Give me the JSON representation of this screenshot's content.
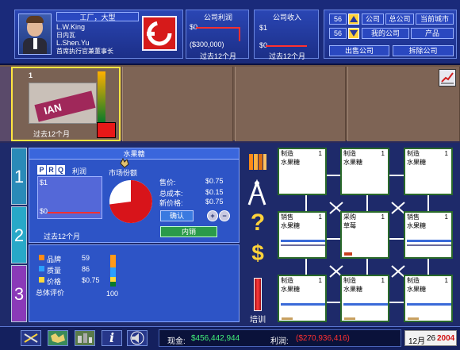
{
  "header": {
    "company_type": "工厂，大型",
    "people": [
      {
        "name": "L.W.King",
        "role": "日内瓦"
      },
      {
        "name": "L.Shen.Yu",
        "role": "首席执行官兼董事长"
      }
    ],
    "profit": {
      "title": "公司利润",
      "top_value": "$0",
      "amount": "($300,000)",
      "period": "过去12个月"
    },
    "revenue": {
      "title": "公司收入",
      "top_value": "$1",
      "bottom_value": "$0",
      "period": "过去12个月"
    },
    "nav": {
      "row1_num": "56",
      "row2_num": "56",
      "company": "公司",
      "head_office": "总公司",
      "current_city": "当前城市",
      "my_company": "我的公司",
      "product": "产品",
      "sell_company": "出售公司",
      "demolish_company": "拆除公司"
    }
  },
  "slots": [
    {
      "num": "1",
      "period": "过去12个月",
      "product_text": "IAN"
    }
  ],
  "detail": {
    "product_name": "水果糖",
    "pqr": [
      "P",
      "R",
      "Q"
    ],
    "profit_label": "利润",
    "share_label": "市场份额",
    "chart_top": "$1",
    "chart_bottom": "$0",
    "chart_period": "过去12个月",
    "price_label": "售价:",
    "price_value": "$0.75",
    "cost_label": "总成本:",
    "cost_value": "$0.15",
    "new_price_label": "新价格:",
    "new_price_value": "$0.75",
    "confirm": "确认",
    "internal": "内销",
    "stats": [
      {
        "label": "品牌",
        "value": "59",
        "color": "#ff8a18"
      },
      {
        "label": "质量",
        "value": "86",
        "color": "#2aa0ff"
      },
      {
        "label": "价格",
        "value": "$0.75",
        "color": "#ffd83a"
      }
    ],
    "overall_label": "总体评价",
    "overall_value": "100",
    "tabs": [
      "1",
      "2",
      "3"
    ]
  },
  "sidetools": {
    "train_label": "培训"
  },
  "cards": [
    {
      "type": "制造",
      "num": "1",
      "item": "水果糖"
    },
    {
      "type": "制造",
      "num": "1",
      "item": "水果糖"
    },
    {
      "type": "制造",
      "num": "1",
      "item": "水果糖"
    },
    {
      "type": "销售",
      "num": "1",
      "item": "水果糖"
    },
    {
      "type": "采购",
      "num": "1",
      "item": "草莓"
    },
    {
      "type": "销售",
      "num": "1",
      "item": "水果糖"
    },
    {
      "type": "制造",
      "num": "1",
      "item": "水果糖"
    },
    {
      "type": "制造",
      "num": "1",
      "item": "水果糖"
    },
    {
      "type": "制造",
      "num": "1",
      "item": "水果糖"
    }
  ],
  "footer": {
    "cash_label": "现金:",
    "cash_value": "$456,442,944",
    "profit_label": "利润:",
    "profit_value": "($270,936,416)",
    "month": "12月",
    "day": "26",
    "year": "2004"
  },
  "colors": {
    "accent_yellow": "#ffe640",
    "profit_red": "#ff3030",
    "cash_green": "#43f07a"
  }
}
